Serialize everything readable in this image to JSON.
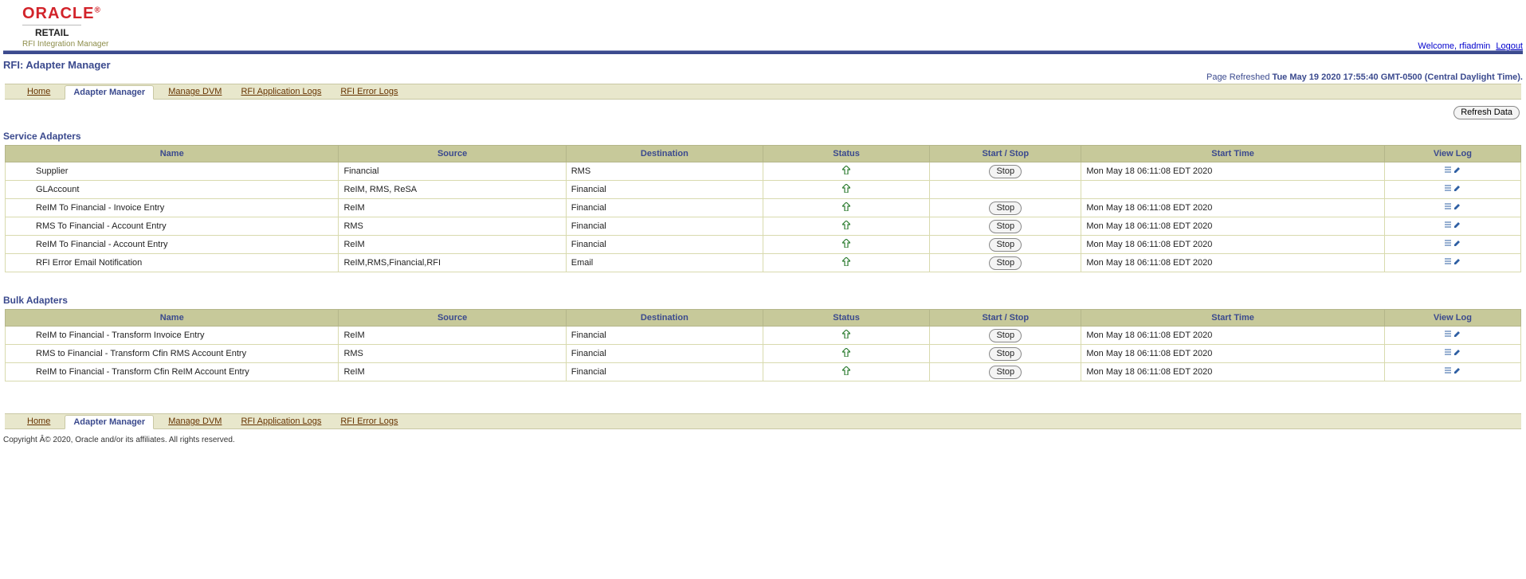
{
  "brand": {
    "name": "ORACLE",
    "sub1": "RETAIL",
    "sub2": "RFI Integration Manager"
  },
  "topRight": {
    "welcome": "Welcome, rfiadmin",
    "logout": "Logout"
  },
  "pageTitle": "RFI: Adapter Manager",
  "pageRefresh": {
    "label": "Page Refreshed",
    "value": "Tue May 19 2020 17:55:40 GMT-0500 (Central Daylight Time)."
  },
  "tabs": {
    "home": "Home",
    "adapterManager": "Adapter Manager",
    "manageDVM": "Manage DVM",
    "appLogs": "RFI Application Logs",
    "errLogs": "RFI Error Logs"
  },
  "refreshButton": "Refresh Data",
  "headers": {
    "name": "Name",
    "source": "Source",
    "destination": "Destination",
    "status": "Status",
    "startStop": "Start / Stop",
    "startTime": "Start Time",
    "viewLog": "View Log"
  },
  "sections": {
    "service": "Service Adapters",
    "bulk": "Bulk Adapters"
  },
  "stopLabel": "Stop",
  "serviceRows": [
    {
      "name": "Supplier",
      "source": "Financial",
      "dest": "RMS",
      "status": "up",
      "btn": "Stop",
      "time": "Mon May 18 06:11:08 EDT 2020",
      "log": true
    },
    {
      "name": "GLAccount",
      "source": "ReIM, RMS, ReSA",
      "dest": "Financial",
      "status": "up",
      "btn": "",
      "time": "",
      "log": true
    },
    {
      "name": "ReIM To Financial - Invoice Entry",
      "source": "ReIM",
      "dest": "Financial",
      "status": "up",
      "btn": "Stop",
      "time": "Mon May 18 06:11:08 EDT 2020",
      "log": true
    },
    {
      "name": "RMS To Financial - Account Entry",
      "source": "RMS",
      "dest": "Financial",
      "status": "up",
      "btn": "Stop",
      "time": "Mon May 18 06:11:08 EDT 2020",
      "log": true
    },
    {
      "name": "ReIM To Financial - Account Entry",
      "source": "ReIM",
      "dest": "Financial",
      "status": "up",
      "btn": "Stop",
      "time": "Mon May 18 06:11:08 EDT 2020",
      "log": true
    },
    {
      "name": "RFI Error Email Notification",
      "source": "ReIM,RMS,Financial,RFI",
      "dest": "Email",
      "status": "up",
      "btn": "Stop",
      "time": "Mon May 18 06:11:08 EDT 2020",
      "log": true
    }
  ],
  "bulkRows": [
    {
      "name": "ReIM to Financial - Transform Invoice Entry",
      "source": "ReIM",
      "dest": "Financial",
      "status": "up",
      "btn": "Stop",
      "time": "Mon May 18 06:11:08 EDT 2020",
      "log": true
    },
    {
      "name": "RMS to Financial - Transform Cfin RMS Account Entry",
      "source": "RMS",
      "dest": "Financial",
      "status": "up",
      "btn": "Stop",
      "time": "Mon May 18 06:11:08 EDT 2020",
      "log": true
    },
    {
      "name": "ReIM to Financial - Transform Cfin ReIM Account Entry",
      "source": "ReIM",
      "dest": "Financial",
      "status": "up",
      "btn": "Stop",
      "time": "Mon May 18 06:11:08 EDT 2020",
      "log": true
    }
  ],
  "copyright": "Copyright Â© 2020, Oracle and/or its affiliates. All rights reserved."
}
